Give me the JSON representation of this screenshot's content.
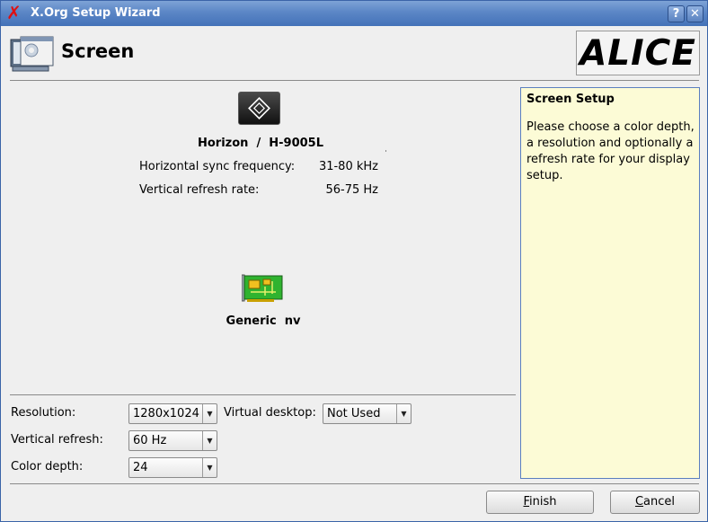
{
  "window": {
    "title": "X.Org Setup Wizard",
    "help_button": "?",
    "close_button": "✕"
  },
  "header": {
    "page_title": "Screen",
    "logo_text": "ALICE"
  },
  "monitor": {
    "icon": "monitor-icon",
    "name": "Horizon  /  H-9005L",
    "hsync_label": "Horizontal sync frequency:",
    "hsync_value": "31-80 kHz",
    "vrefresh_label": "Vertical refresh rate:",
    "vrefresh_value": "56-75 Hz"
  },
  "video_card": {
    "icon": "video-card-icon",
    "name": "Generic  nv"
  },
  "settings": {
    "resolution_label": "Resolution:",
    "resolution_value": "1280x1024",
    "virtual_desktop_label": "Virtual desktop:",
    "virtual_desktop_value": "Not Used",
    "vertical_refresh_label": "Vertical refresh:",
    "vertical_refresh_value": "60 Hz",
    "color_depth_label": "Color depth:",
    "color_depth_value": "24"
  },
  "help": {
    "title": "Screen Setup",
    "text": "Please choose a color depth, a resolution and optionally a refresh rate for your display setup."
  },
  "buttons": {
    "finish_prefix": "F",
    "finish_rest": "inish",
    "cancel_prefix": "C",
    "cancel_rest": "ancel"
  },
  "colors": {
    "titlebar": "#5b86c6",
    "help_background": "#fcfbd6",
    "help_border": "#5b7fbf",
    "app_icon": "#e01010"
  }
}
